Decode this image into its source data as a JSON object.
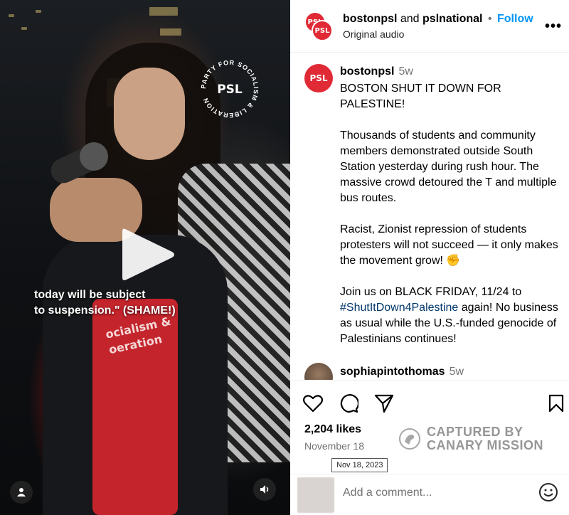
{
  "video": {
    "subtitle": "today will be subject\nto suspension.\" (SHAME!)",
    "badge_text": "PARTY FOR SOCIALISM & LIBERATION",
    "badge_logo": "PSL",
    "shirt_text": "ocialism &\noeration",
    "icons": {
      "play": "play-icon",
      "user": "user-icon",
      "audio": "speaker-icon"
    }
  },
  "header": {
    "avatar_text": "PSL",
    "user1": "bostonpsl",
    "and": " and ",
    "user2": "pslnational",
    "dot": "•",
    "follow": "Follow",
    "subtitle": "Original audio",
    "more": "•••"
  },
  "caption": {
    "avatar_text": "PSL",
    "username": "bostonpsl",
    "time": "5w",
    "p1": "BOSTON SHUT IT DOWN FOR PALESTINE!",
    "p2": "Thousands of students and community members demonstrated outside South Station yesterday during rush hour. The massive crowd detoured the T and multiple bus routes.",
    "p3": "Racist, Zionist repression of students protesters will not succeed — it only makes the movement grow! ✊",
    "p4_before": "Join us on BLACK FRIDAY, 11/24 to ",
    "p4_hashtag": "#ShutItDown4Palestine",
    "p4_after": " again! No business as usual while the U.S.-funded genocide of Palestinians continues!"
  },
  "comment": {
    "username": "sophiapintothomas",
    "time": "5w"
  },
  "actions": {
    "icons": [
      "heart-icon",
      "comment-icon",
      "share-icon",
      "bookmark-icon"
    ],
    "likes": "2,204 likes",
    "date": "November 18",
    "tooltip": "Nov 18, 2023"
  },
  "watermark": {
    "line1": "CAPTURED BY",
    "line2": "CANARY MISSION"
  },
  "comment_box": {
    "placeholder": "Add a comment..."
  },
  "colors": {
    "accent": "#0095f6",
    "psl_red": "#e02a36",
    "hashtag": "#00376b",
    "muted": "#737373"
  }
}
